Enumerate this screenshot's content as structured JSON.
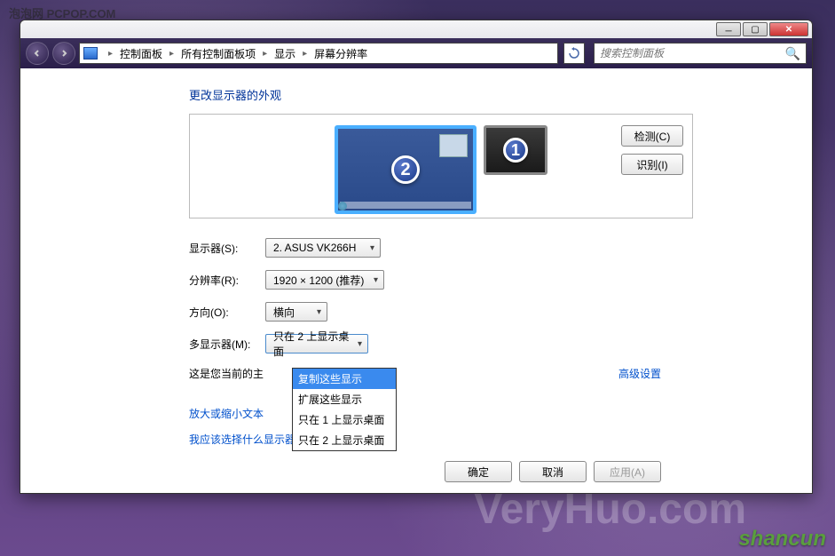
{
  "watermarks": {
    "pcpop": "泡泡网 PCPOP.COM",
    "veryhuo": "VeryHuo.com",
    "shancun": "shancun"
  },
  "breadcrumb": {
    "items": [
      "控制面板",
      "所有控制面板项",
      "显示",
      "屏幕分辨率"
    ]
  },
  "search": {
    "placeholder": "搜索控制面板"
  },
  "page": {
    "title": "更改显示器的外观"
  },
  "monitors": {
    "primary": "2",
    "secondary": "1"
  },
  "buttons": {
    "detect": "检测(C)",
    "identify": "识别(I)",
    "ok": "确定",
    "cancel": "取消",
    "apply": "应用(A)"
  },
  "form": {
    "display_label": "显示器(S):",
    "display_value": "2. ASUS VK266H",
    "resolution_label": "分辨率(R):",
    "resolution_value": "1920 × 1200 (推荐)",
    "orientation_label": "方向(O):",
    "orientation_value": "横向",
    "multimon_label": "多显示器(M):",
    "multimon_value": "只在 2 上显示桌面"
  },
  "dropdown": {
    "items": [
      "复制这些显示",
      "扩展这些显示",
      "只在 1 上显示桌面",
      "只在 2 上显示桌面"
    ],
    "selected_index": 0
  },
  "status": {
    "current_main": "这是您当前的主",
    "advanced": "高级设置"
  },
  "links": {
    "text_size": "放大或缩小文本",
    "help": "我应该选择什么显示器设置?"
  }
}
